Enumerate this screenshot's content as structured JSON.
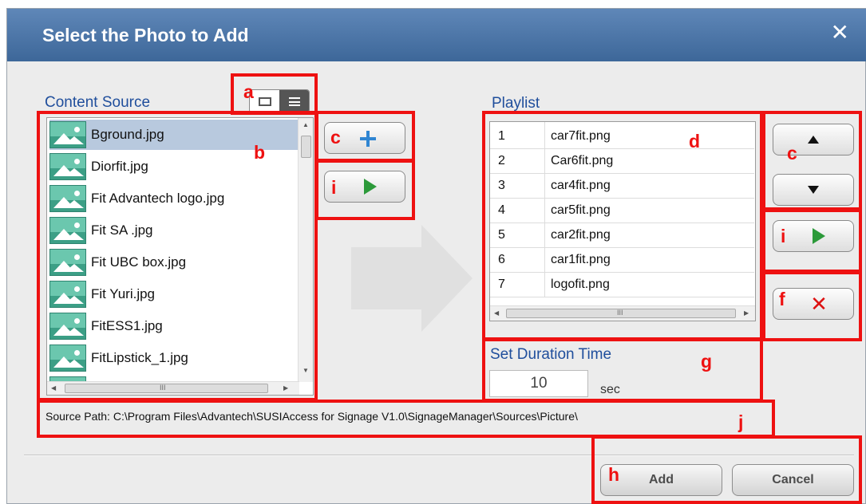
{
  "dialog": {
    "title": "Select the Photo to Add",
    "close_glyph": "✕"
  },
  "content_source": {
    "label": "Content Source",
    "view_modes": [
      "thumbnail",
      "list"
    ],
    "active_view": "list",
    "files": [
      "Bground.jpg",
      "Diorfit.jpg",
      "Fit Advantech logo.jpg",
      "Fit SA .jpg",
      "Fit UBC box.jpg",
      "Fit Yuri.jpg",
      "FitESS1.jpg",
      "FitLipstick_1.jpg"
    ],
    "selected_index": 0,
    "scroll_glyph": "III"
  },
  "playlist": {
    "label": "Playlist",
    "items": [
      {
        "num": "1",
        "name": "car7fit.png"
      },
      {
        "num": "2",
        "name": "Car6fit.png"
      },
      {
        "num": "3",
        "name": "car4fit.png"
      },
      {
        "num": "4",
        "name": "car5fit.png"
      },
      {
        "num": "5",
        "name": "car2fit.png"
      },
      {
        "num": "6",
        "name": "car1fit.png"
      },
      {
        "num": "7",
        "name": "logofit.png"
      }
    ],
    "scroll_glyph": "III"
  },
  "duration": {
    "label": "Set Duration Time",
    "value": "10",
    "unit": "sec"
  },
  "source_path": "Source Path: C:\\Program Files\\Advantech\\SUSIAccess for Signage V1.0\\SignageManager\\Sources\\Picture\\",
  "actions": {
    "add": "Add",
    "cancel": "Cancel"
  },
  "annotations": {
    "a": "a",
    "b": "b",
    "c": "c",
    "d": "d",
    "f": "f",
    "g": "g",
    "h": "h",
    "i": "i",
    "j": "j"
  },
  "colors": {
    "annotation": "#ee1111",
    "titlebar": "#4d76a8",
    "section_label": "#1f4e9c",
    "play": "#2c9a3a",
    "add_plus": "#2f85d2",
    "delete": "#dd1111"
  },
  "icons": [
    "close-icon",
    "thumbnail-view-icon",
    "list-view-icon",
    "image-file-icon",
    "plus-icon",
    "play-icon",
    "move-up-icon",
    "move-down-icon",
    "delete-icon",
    "transfer-arrow-icon"
  ]
}
